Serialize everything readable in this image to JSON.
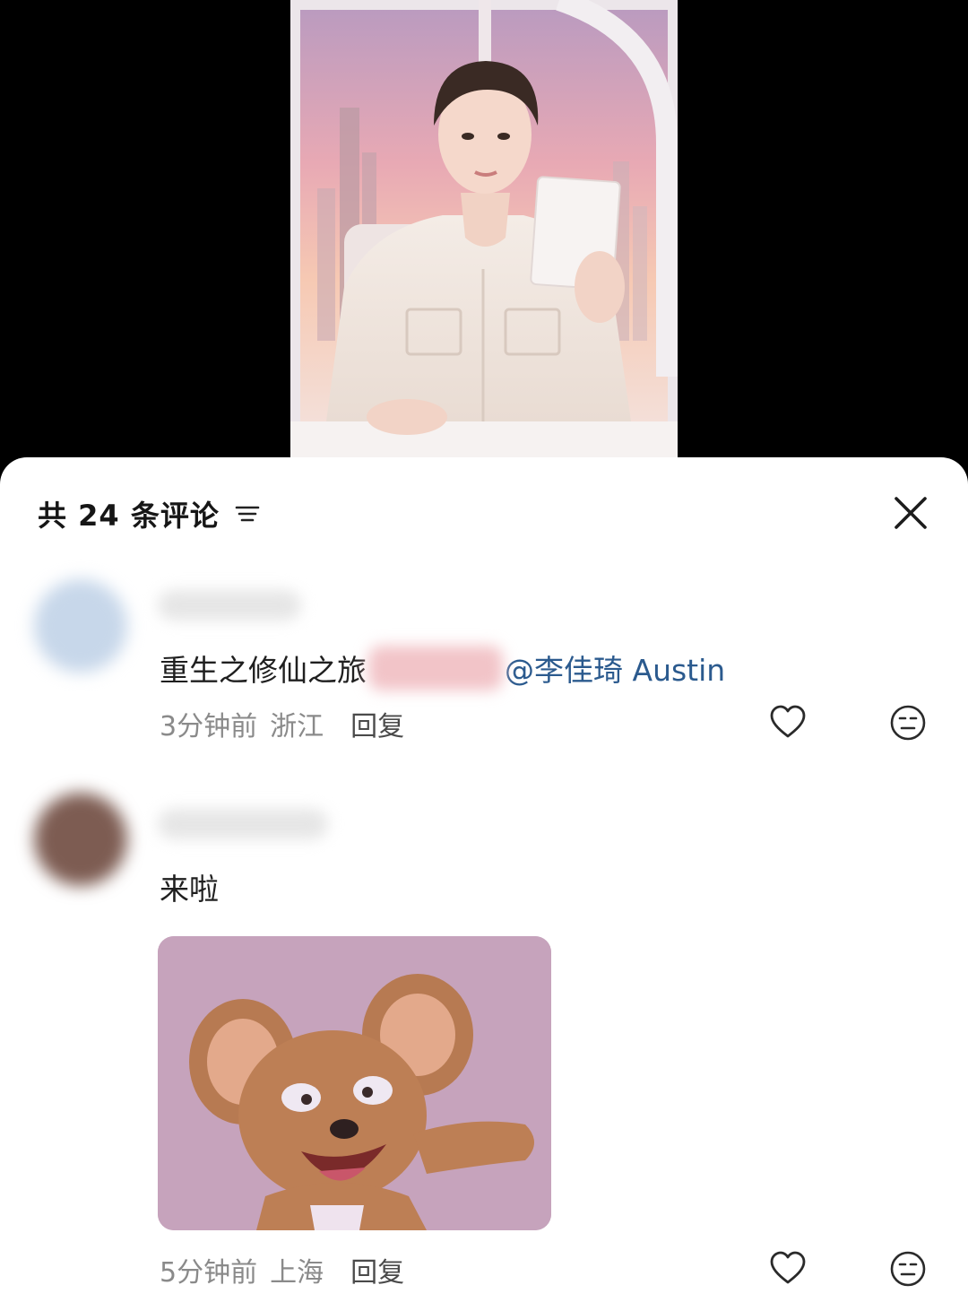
{
  "header": {
    "comment_count_label": "共 24 条评论",
    "sort_icon": "sort-lines-icon",
    "close_icon": "close-x-icon"
  },
  "comments": [
    {
      "text_before": "重生之修仙之旅",
      "mention": "@李佳琦 Austin",
      "time": "3分钟前",
      "location": "浙江",
      "reply_label": "回复",
      "like_icon": "heart-outline-icon",
      "dislike_icon": "meh-face-icon"
    },
    {
      "text": "来啦",
      "sticker": "jerry-mouse-sticker",
      "time": "5分钟前",
      "location": "上海",
      "reply_label": "回复",
      "like_icon": "heart-outline-icon",
      "dislike_icon": "meh-face-icon"
    }
  ],
  "colors": {
    "mention": "#2b5a8e",
    "meta_text": "#8a8a8a",
    "sheet_bg": "#ffffff"
  }
}
